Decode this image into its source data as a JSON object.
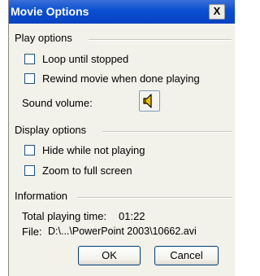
{
  "window": {
    "title": "Movie Options",
    "close_glyph": "X"
  },
  "play_options": {
    "label": "Play options",
    "loop": {
      "label": "Loop until stopped",
      "checked": false
    },
    "rewind": {
      "label": "Rewind movie when done playing",
      "checked": false
    },
    "sound_volume_label": "Sound volume:",
    "sound_icon": "speaker-icon"
  },
  "display_options": {
    "label": "Display options",
    "hide": {
      "label": "Hide while not playing",
      "checked": false
    },
    "zoom": {
      "label": "Zoom to full screen",
      "checked": false
    }
  },
  "information": {
    "label": "Information",
    "total_time_label": "Total playing time:",
    "total_time_value": "01:22",
    "file_label": "File:",
    "file_value": "D:\\...\\PowerPoint 2003\\10662.avi"
  },
  "buttons": {
    "ok": "OK",
    "cancel": "Cancel"
  },
  "colors": {
    "titlebar": "#0a4fd0",
    "dialog_bg": "#f2f1ea",
    "speaker": "#f2c200"
  }
}
